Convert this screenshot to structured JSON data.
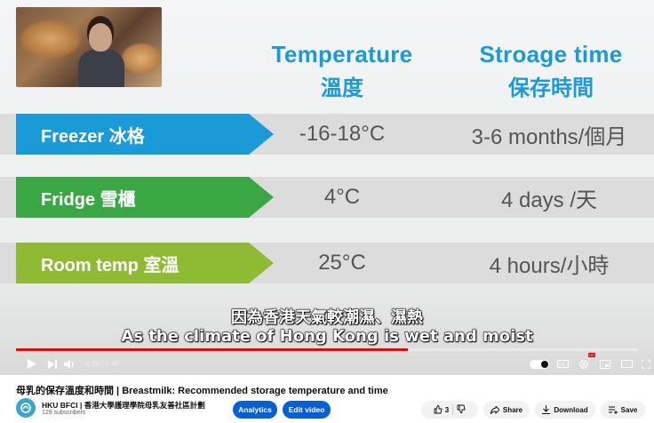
{
  "slide": {
    "headers": [
      {
        "en": "Temperature",
        "zh": "溫度"
      },
      {
        "en": "Stroage time",
        "zh": "保存時間"
      }
    ],
    "rows": [
      {
        "label": "Freezer 冰格",
        "temp": "-16-18°C",
        "time": "3-6 months/個月",
        "color": "#1a9ad6"
      },
      {
        "label": "Fridge 雪櫃",
        "temp": "4°C",
        "time": "4 days /天",
        "color": "#3aa745"
      },
      {
        "label": "Room temp 室溫",
        "temp": "25°C",
        "time": "4 hours/小時",
        "color": "#8fbb34"
      }
    ]
  },
  "subtitles": {
    "zh": "因為香港天氣較潮濕、濕熱",
    "en": "As the climate of Hong Kong is wet and moist"
  },
  "player": {
    "time": "0:29 / 0:46",
    "progress": 0.63,
    "hd_badge": "HD",
    "accent": "#ff0000"
  },
  "video": {
    "title": "母乳的保存溫度和時間 | Breastmilk: Recommended storage temperature and time",
    "channel": "HKU BFCI | 香港大學護理學院母乳友善社區計劃",
    "subscribers": "129 subscribers",
    "analytics": "Analytics",
    "edit": "Edit video",
    "likes": "3",
    "share": "Share",
    "download": "Download",
    "save": "Save"
  },
  "icons": [
    "play-icon",
    "next-icon",
    "volume-icon",
    "autoplay-toggle",
    "cc-icon",
    "settings-icon",
    "miniplayer-icon",
    "theater-icon",
    "fullscreen-icon",
    "like-icon",
    "dislike-icon",
    "share-icon",
    "download-icon",
    "save-icon"
  ]
}
